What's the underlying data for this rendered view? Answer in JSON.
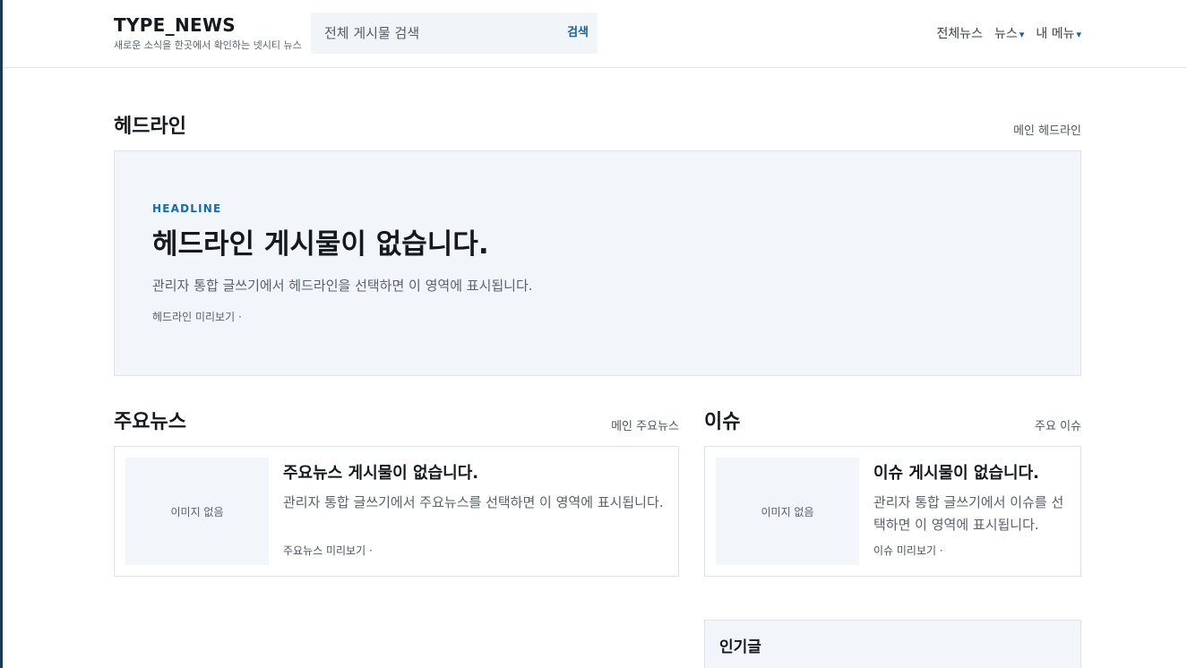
{
  "brand": {
    "title": "TYPE_NEWS",
    "subtitle": "새로운 소식을 한곳에서 확인하는 넷시티 뉴스"
  },
  "search": {
    "placeholder": "전체 게시물 검색",
    "button_label": "검색"
  },
  "nav": {
    "items": [
      {
        "label": "전체뉴스",
        "dropdown": false
      },
      {
        "label": "뉴스",
        "dropdown": true
      },
      {
        "label": "내 메뉴",
        "dropdown": true
      }
    ],
    "caret": "▾"
  },
  "headline": {
    "section_title": "헤드라인",
    "section_link": "메인 헤드라인",
    "kicker": "HEADLINE",
    "title": "헤드라인 게시물이 없습니다.",
    "description": "관리자 통합 글쓰기에서 헤드라인을 선택하면 이 영역에 표시됩니다.",
    "meta": "헤드라인 미리보기 ·"
  },
  "main_news": {
    "section_title": "주요뉴스",
    "section_link": "메인 주요뉴스",
    "thumb_label": "이미지 없음",
    "title": "주요뉴스 게시물이 없습니다.",
    "description": "관리자 통합 글쓰기에서 주요뉴스를 선택하면 이 영역에 표시됩니다.",
    "meta": "주요뉴스 미리보기 ·"
  },
  "issue": {
    "section_title": "이슈",
    "section_link": "주요 이슈",
    "thumb_label": "이미지 없음",
    "title": "이슈 게시물이 없습니다.",
    "description": "관리자 통합 글쓰기에서 이슈를 선택하면 이 영역에 표시됩니다.",
    "meta": "이슈 미리보기 ·"
  },
  "popular": {
    "title": "인기글"
  },
  "colors": {
    "accent": "#1a6aa8",
    "panel_bg": "#f2f5f9",
    "left_rail": "#1e3a52"
  }
}
